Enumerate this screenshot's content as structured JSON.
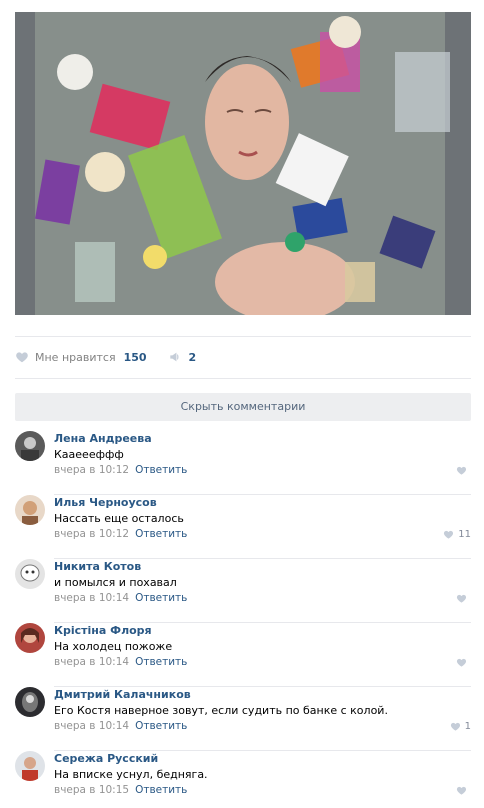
{
  "post": {
    "like_label": "Мне нравится",
    "like_count": "150",
    "share_count": "2"
  },
  "hide_comments_label": "Скрыть комментарии",
  "comments": [
    {
      "author": "Лена Андреева",
      "text": "Кааеееффф",
      "time": "вчера в 10:12",
      "reply": "Ответить",
      "likes": ""
    },
    {
      "author": "Илья Черноусов",
      "text": "Нассать еще осталось",
      "time": "вчера в 10:12",
      "reply": "Ответить",
      "likes": "11"
    },
    {
      "author": "Никита Котов",
      "text": "и помылся и похавал",
      "time": "вчера в 10:14",
      "reply": "Ответить",
      "likes": ""
    },
    {
      "author": "Крістіна Флоря",
      "text": "На холодец пожоже",
      "time": "вчера в 10:14",
      "reply": "Ответить",
      "likes": ""
    },
    {
      "author": "Дмитрий Калачников",
      "text": "Его Костя наверное зовут, если судить по банке с колой.",
      "time": "вчера в 10:14",
      "reply": "Ответить",
      "likes": "1"
    },
    {
      "author": "Сережа Русский",
      "text": "На вписке уснул, бедняга.",
      "time": "вчера в 10:15",
      "reply": "Ответить",
      "likes": ""
    }
  ],
  "colors": {
    "link": "#2a5885",
    "meta": "#939393",
    "divider": "#e7e8ec",
    "button_bg": "#edeef0"
  }
}
